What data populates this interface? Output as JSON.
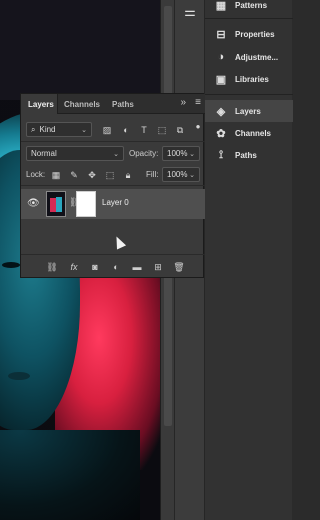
{
  "dock": {
    "items": [
      {
        "label": "Patterns",
        "icon": "patterns-icon"
      },
      {
        "label": "Properties",
        "icon": "properties-icon"
      },
      {
        "label": "Adjustme...",
        "icon": "adjustments-icon"
      },
      {
        "label": "Libraries",
        "icon": "libraries-icon"
      },
      {
        "label": "Layers",
        "icon": "layers-icon"
      },
      {
        "label": "Channels",
        "icon": "channels-icon"
      },
      {
        "label": "Paths",
        "icon": "paths-icon"
      }
    ]
  },
  "layers_panel": {
    "tabs": [
      "Layers",
      "Channels",
      "Paths"
    ],
    "collapse_glyph": "»",
    "menu_glyph": "≡",
    "filter_kind": "Kind",
    "blend_mode": "Normal",
    "opacity_label": "Opacity:",
    "opacity_value": "100%",
    "lock_label": "Lock:",
    "fill_label": "Fill:",
    "fill_value": "100%",
    "layer": {
      "name": "Layer 0"
    }
  },
  "colors": {
    "panel_bg": "#3a3a3a",
    "dock_bg": "#323232",
    "selected_row": "#4f4f4f"
  }
}
